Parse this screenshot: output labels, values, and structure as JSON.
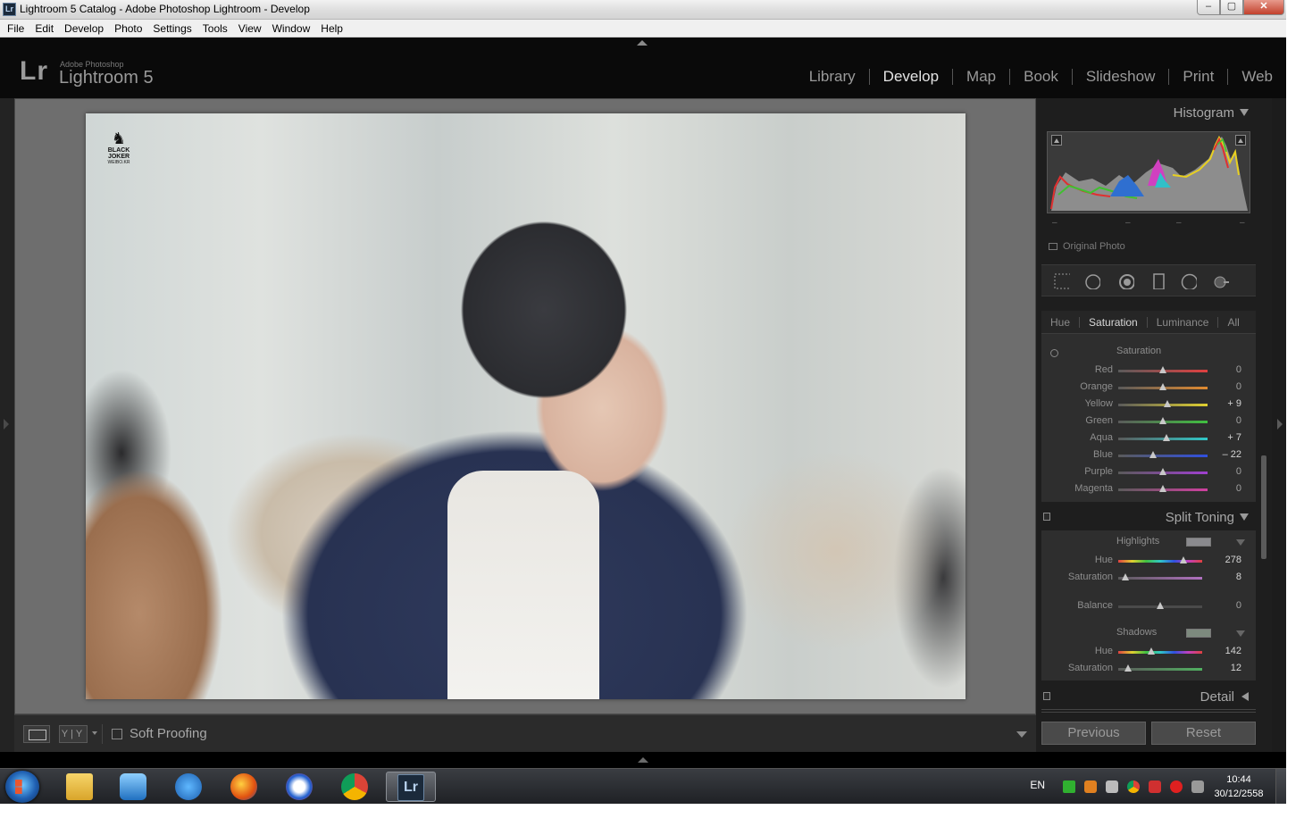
{
  "window": {
    "title": "Lightroom 5 Catalog - Adobe Photoshop Lightroom - Develop",
    "icon_label": "Lr",
    "buttons": {
      "minimize": "–",
      "maximize": "▢",
      "close": "✕"
    }
  },
  "menu": [
    "File",
    "Edit",
    "Develop",
    "Photo",
    "Settings",
    "Tools",
    "View",
    "Window",
    "Help"
  ],
  "header": {
    "logo": "Lr",
    "brand_small": "Adobe Photoshop",
    "product": "Lightroom 5",
    "modules": [
      {
        "label": "Library",
        "active": false
      },
      {
        "label": "Develop",
        "active": true
      },
      {
        "label": "Map",
        "active": false
      },
      {
        "label": "Book",
        "active": false
      },
      {
        "label": "Slideshow",
        "active": false
      },
      {
        "label": "Print",
        "active": false
      },
      {
        "label": "Web",
        "active": false
      }
    ]
  },
  "photo": {
    "watermark_mark": "♞",
    "watermark_brand": "BLACK JOKER",
    "watermark_sub": "WEIBO.KR"
  },
  "toolbar": {
    "view_mode_label": "Y|Y",
    "soft_proofing_label": "Soft Proofing",
    "soft_proofing_checked": false
  },
  "panels": {
    "histogram": {
      "title": "Histogram",
      "original_photo_label": "Original Photo",
      "readouts": [
        "–",
        "–",
        "–",
        "–"
      ]
    },
    "hsl": {
      "tabs": [
        "Hue",
        "Saturation",
        "Luminance",
        "All"
      ],
      "active_tab": "Saturation",
      "section_title": "Saturation",
      "sliders": [
        {
          "label": "Red",
          "value": "0",
          "pos": 0.5,
          "colors": [
            "#5a5a5a",
            "#e04040"
          ]
        },
        {
          "label": "Orange",
          "value": "0",
          "pos": 0.5,
          "colors": [
            "#5a5a5a",
            "#e08a30"
          ]
        },
        {
          "label": "Yellow",
          "value": "+ 9",
          "pos": 0.545,
          "colors": [
            "#5a5a5a",
            "#e0d030"
          ]
        },
        {
          "label": "Green",
          "value": "0",
          "pos": 0.5,
          "colors": [
            "#5a5a5a",
            "#40c040"
          ]
        },
        {
          "label": "Aqua",
          "value": "+ 7",
          "pos": 0.535,
          "colors": [
            "#5a5a5a",
            "#30c8c8"
          ]
        },
        {
          "label": "Blue",
          "value": "– 22",
          "pos": 0.39,
          "colors": [
            "#5a5a5a",
            "#3050e0"
          ]
        },
        {
          "label": "Purple",
          "value": "0",
          "pos": 0.5,
          "colors": [
            "#5a5a5a",
            "#a040d0"
          ]
        },
        {
          "label": "Magenta",
          "value": "0",
          "pos": 0.5,
          "colors": [
            "#5a5a5a",
            "#d040a0"
          ]
        }
      ]
    },
    "split_toning": {
      "title": "Split Toning",
      "highlights_label": "Highlights",
      "highlights_swatch": "#8a8a8e",
      "highlights_hue": {
        "label": "Hue",
        "value": "278",
        "pos": 0.772
      },
      "highlights_saturation": {
        "label": "Saturation",
        "value": "8",
        "pos": 0.08
      },
      "balance": {
        "label": "Balance",
        "value": "0",
        "pos": 0.5
      },
      "shadows_label": "Shadows",
      "shadows_swatch": "#7d8a7e",
      "shadows_hue": {
        "label": "Hue",
        "value": "142",
        "pos": 0.394
      },
      "shadows_saturation": {
        "label": "Saturation",
        "value": "12",
        "pos": 0.12
      }
    },
    "detail": {
      "title": "Detail"
    },
    "buttons": {
      "previous": "Previous",
      "reset": "Reset"
    }
  },
  "taskbar": {
    "apps": [
      "explorer-icon",
      "media-player-icon",
      "internet-explorer-icon",
      "firefox-icon",
      "safari-like-icon",
      "chrome-icon",
      "lightroom-icon"
    ],
    "active_app": "lightroom-icon",
    "lightroom_label": "Lr",
    "language": "EN",
    "time": "10:44",
    "date": "30/12/2558"
  },
  "colors": {
    "lr_bg": "#0a0a0a",
    "panel_bg": "#1e1e1e",
    "workspace": "#6e6e6e"
  }
}
